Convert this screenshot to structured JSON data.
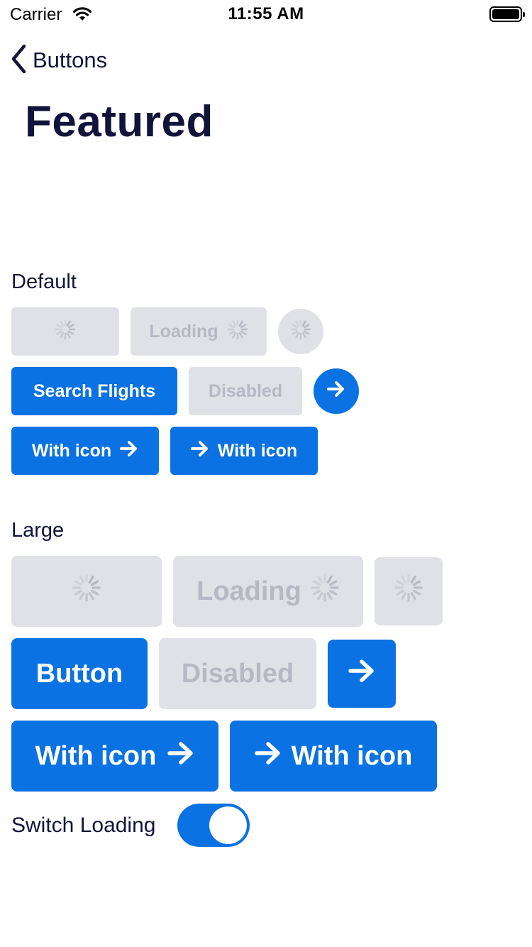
{
  "status_bar": {
    "carrier": "Carrier",
    "time": "11:55 AM",
    "icons": [
      "wifi-icon",
      "battery-icon"
    ]
  },
  "nav": {
    "back_label": "Buttons",
    "back_icon": "chevron-left-icon"
  },
  "page": {
    "title": "Featured"
  },
  "sections": {
    "default": {
      "label": "Default",
      "loading_label": "Loading",
      "primary_label": "Search Flights",
      "disabled_label": "Disabled",
      "icon_right_label": "With icon",
      "icon_left_label": "With icon"
    },
    "large": {
      "label": "Large",
      "loading_label": "Loading",
      "primary_label": "Button",
      "disabled_label": "Disabled",
      "icon_right_label": "With icon",
      "icon_left_label": "With icon"
    }
  },
  "switch": {
    "label": "Switch Loading",
    "on": true
  },
  "colors": {
    "primary": "#0a72e2",
    "disabled_bg": "#e0e1e6",
    "disabled_text": "#b6b8c4",
    "text": "#11133a"
  }
}
